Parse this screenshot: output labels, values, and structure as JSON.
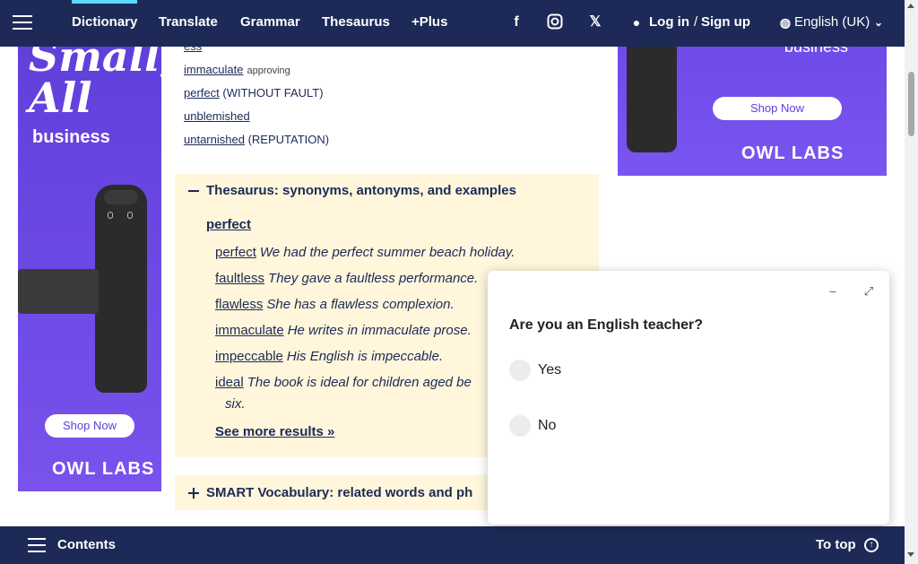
{
  "nav": {
    "items": [
      {
        "label": "Dictionary",
        "active": true
      },
      {
        "label": "Translate"
      },
      {
        "label": "Grammar"
      },
      {
        "label": "Thesaurus"
      },
      {
        "label": "+Plus"
      }
    ],
    "social_icons": [
      "facebook-icon",
      "instagram-icon",
      "x-twitter-icon"
    ],
    "login": "Log in",
    "separator": "/",
    "signup": "Sign up",
    "language": "English (UK)"
  },
  "ad_left": {
    "headline_1": "Small,",
    "headline_2": "All",
    "business": "business",
    "cta": "Shop Now",
    "brand": "OWL LABS"
  },
  "ad_right": {
    "business": "business",
    "cta": "Shop Now",
    "brand": "OWL LABS"
  },
  "synonyms_list": [
    {
      "word": "ess",
      "note": "",
      "paren": ""
    },
    {
      "word": "immaculate",
      "note": "approving",
      "paren": ""
    },
    {
      "word": "perfect",
      "note": "",
      "paren": "(WITHOUT FAULT)"
    },
    {
      "word": "unblemished",
      "note": "",
      "paren": ""
    },
    {
      "word": "untarnished",
      "note": "",
      "paren": "(REPUTATION)"
    }
  ],
  "thesaurus": {
    "title": "Thesaurus: synonyms, antonyms, and examples",
    "headword": "perfect",
    "examples": [
      {
        "word": "perfect",
        "sentence": "We had the perfect summer beach holiday."
      },
      {
        "word": "faultless",
        "sentence": "They gave a faultless performance."
      },
      {
        "word": "flawless",
        "sentence": "She has a flawless complexion."
      },
      {
        "word": "immaculate",
        "sentence": "He writes in immaculate prose."
      },
      {
        "word": "impeccable",
        "sentence": "His English is impeccable."
      },
      {
        "word": "ideal",
        "sentence": "The book is ideal for children aged be"
      }
    ],
    "wrap_text": "six.",
    "see_more": "See more results »"
  },
  "smart_vocab": {
    "title": "SMART Vocabulary: related words and ph"
  },
  "popup": {
    "question": "Are you an English teacher?",
    "options": [
      "Yes",
      "No"
    ]
  },
  "bottom": {
    "contents": "Contents",
    "to_top": "To top"
  }
}
